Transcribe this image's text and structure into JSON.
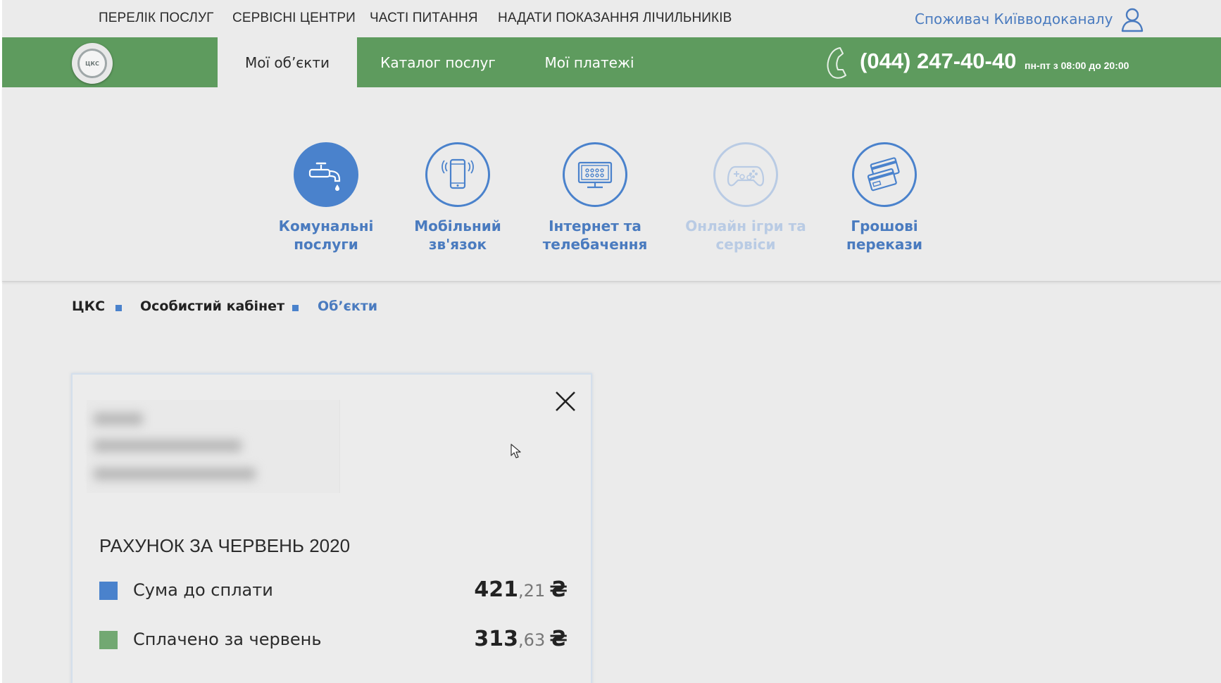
{
  "top_links": [
    {
      "label": "ПЕРЕЛІК ПОСЛУГ"
    },
    {
      "label": "СЕРВІСНІ ЦЕНТРИ"
    },
    {
      "label": "ЧАСТІ ПИТАННЯ"
    },
    {
      "label": "НАДАТИ ПОКАЗАННЯ ЛІЧИЛЬНИКІВ"
    }
  ],
  "user": {
    "label": "Споживач Київводоканалу",
    "icon": "user-icon"
  },
  "logo": {
    "text": "ЦКС"
  },
  "nav": {
    "tabs": [
      {
        "label": "Мої об’єкти",
        "active": true
      },
      {
        "label": "Каталог послуг",
        "active": false
      },
      {
        "label": "Мої платежі",
        "active": false
      }
    ]
  },
  "phone": {
    "number": "(044) 247-40-40",
    "hours": "пн-пт з 08:00 до 20:00",
    "icon": "phone-icon"
  },
  "categories": [
    {
      "line1": "Комунальні",
      "line2": "послуги",
      "icon": "water-tap-icon",
      "state": "active"
    },
    {
      "line1": "Мобільний",
      "line2": "зв'язок",
      "icon": "mobile-phone-icon",
      "state": "normal"
    },
    {
      "line1": "Інтернет та",
      "line2": "телебачення",
      "icon": "tv-icon",
      "state": "normal"
    },
    {
      "line1": "Онлайн ігри та",
      "line2": "сервіси",
      "icon": "gamepad-icon",
      "state": "disabled"
    },
    {
      "line1": "Грошові",
      "line2": "перекази",
      "icon": "cards-icon",
      "state": "normal"
    }
  ],
  "breadcrumb": [
    {
      "label": "ЦКС"
    },
    {
      "label": "Особистий кабінет"
    },
    {
      "label": "Об’єкти"
    }
  ],
  "card": {
    "bill_title": "РАХУНОК ЗА ЧЕРВЕНЬ 2020",
    "rows": [
      {
        "label": "Сума до сплати",
        "int": "421",
        "dec": ",21",
        "currency": "₴",
        "color": "#4a82cc"
      },
      {
        "label": "Сплачено за червень",
        "int": "313",
        "dec": ",63",
        "currency": "₴",
        "color": "#72a872"
      }
    ]
  },
  "colors": {
    "green": "#5e9b5e",
    "accent_blue": "#4a82cc",
    "link_blue": "#4a7bbf",
    "page_bg": "#ebebeb"
  }
}
